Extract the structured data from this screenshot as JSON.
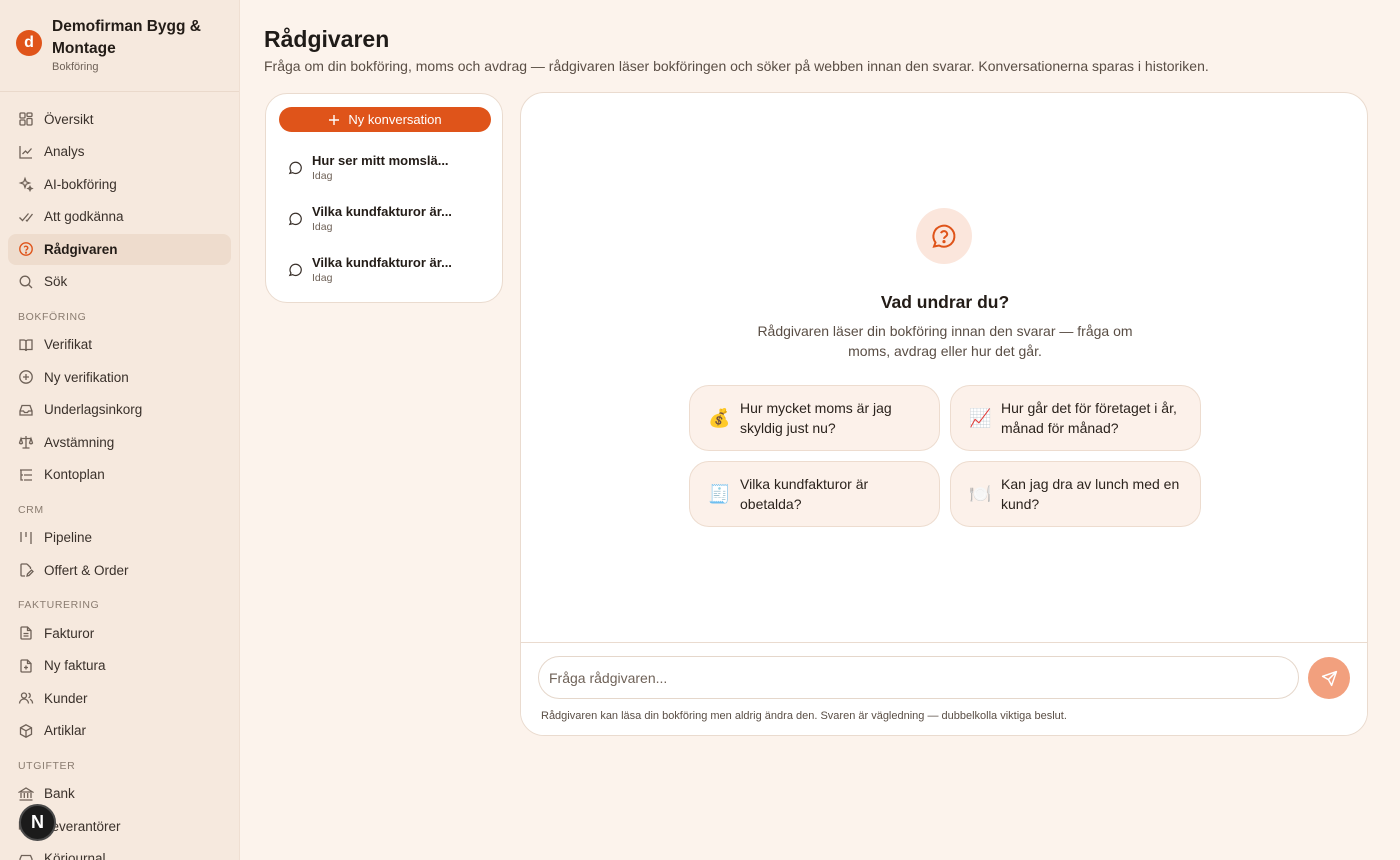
{
  "brand": {
    "initial": "d",
    "name": "Demofirman Bygg & Montage",
    "subtitle": "Bokföring"
  },
  "nav": {
    "main": [
      {
        "label": "Översikt",
        "icon": "grid-icon"
      },
      {
        "label": "Analys",
        "icon": "chart-line-icon"
      },
      {
        "label": "AI-bokföring",
        "icon": "sparkles-icon"
      },
      {
        "label": "Att godkänna",
        "icon": "double-check-icon"
      },
      {
        "label": "Rådgivaren",
        "icon": "help-circle-icon",
        "active": true
      },
      {
        "label": "Sök",
        "icon": "search-icon"
      }
    ],
    "bokforing_title": "BOKFÖRING",
    "bokforing": [
      {
        "label": "Verifikat",
        "icon": "book-icon"
      },
      {
        "label": "Ny verifikation",
        "icon": "plus-circle-icon"
      },
      {
        "label": "Underlagsinkorg",
        "icon": "inbox-icon"
      },
      {
        "label": "Avstämning",
        "icon": "scale-icon"
      },
      {
        "label": "Kontoplan",
        "icon": "list-tree-icon"
      }
    ],
    "crm_title": "CRM",
    "crm": [
      {
        "label": "Pipeline",
        "icon": "kanban-icon"
      },
      {
        "label": "Offert & Order",
        "icon": "file-edit-icon"
      }
    ],
    "fakturering_title": "FAKTURERING",
    "fakturering": [
      {
        "label": "Fakturor",
        "icon": "file-text-icon"
      },
      {
        "label": "Ny faktura",
        "icon": "file-plus-icon"
      },
      {
        "label": "Kunder",
        "icon": "users-icon"
      },
      {
        "label": "Artiklar",
        "icon": "package-icon"
      }
    ],
    "utgifter_title": "UTGIFTER",
    "utgifter": [
      {
        "label": "Bank",
        "icon": "bank-icon"
      },
      {
        "label": "Leverantörer",
        "icon": "truck-icon"
      },
      {
        "label": "Körjournal",
        "icon": "car-icon"
      }
    ],
    "badge": "N"
  },
  "page": {
    "title": "Rådgivaren",
    "subtitle": "Fråga om din bokföring, moms och avdrag — rådgivaren läser bokföringen och söker på webben innan den svarar. Konversationerna sparas i historiken."
  },
  "conversations": {
    "new_label": "Ny konversation",
    "items": [
      {
        "title": "Hur ser mitt momslä...",
        "date": "Idag"
      },
      {
        "title": "Vilka kundfakturor är...",
        "date": "Idag"
      },
      {
        "title": "Vilka kundfakturor är...",
        "date": "Idag"
      }
    ]
  },
  "chat": {
    "hero_title": "Vad undrar du?",
    "hero_subtitle": "Rådgivaren läser din bokföring innan den svarar — fråga om moms, avdrag eller hur det går.",
    "suggestions": [
      {
        "emoji": "💰",
        "text": "Hur mycket moms är jag skyldig just nu?"
      },
      {
        "emoji": "📈",
        "text": "Hur går det för företaget i år, månad för månad?"
      },
      {
        "emoji": "🧾",
        "text": "Vilka kundfakturor är obetalda?"
      },
      {
        "emoji": "🍽️",
        "text": "Kan jag dra av lunch med en kund?"
      }
    ],
    "input_placeholder": "Fråga rådgivaren...",
    "disclaimer": "Rådgivaren kan läsa din bokföring men aldrig ändra den. Svaren är vägledning — dubbelkolla viktiga beslut."
  },
  "colors": {
    "accent": "#df541a",
    "sidebar_bg": "#f6e9de",
    "page_bg": "#fcf3ec",
    "active_nav": "#eedccd"
  }
}
